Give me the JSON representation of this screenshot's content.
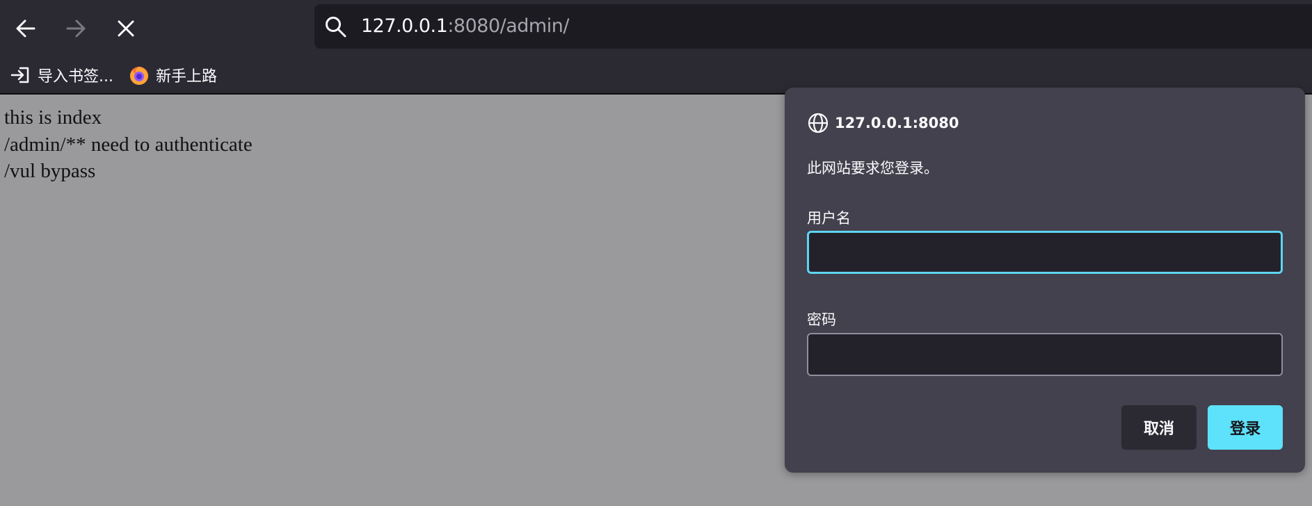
{
  "browser": {
    "url_host": "127.0.0.1",
    "url_rest": ":8080/admin/",
    "bookmarks": [
      {
        "label": "导入书签...",
        "icon": "import-icon"
      },
      {
        "label": "新手上路",
        "icon": "firefox-icon"
      }
    ]
  },
  "page": {
    "lines": [
      "this is index",
      "/admin/** need to authenticate",
      "/vul bypass"
    ]
  },
  "auth_dialog": {
    "origin": "127.0.0.1:8080",
    "message": "此网站要求您登录。",
    "username_label": "用户名",
    "username_value": "",
    "password_label": "密码",
    "password_value": "",
    "cancel_label": "取消",
    "login_label": "登录"
  },
  "colors": {
    "toolbar": "#2b2a33",
    "urlbar": "#1c1b22",
    "dialog": "#42414d",
    "accent": "#5ee1fa",
    "focus_ring": "#5ed5f2",
    "page_overlay": "#9a9a9c"
  }
}
